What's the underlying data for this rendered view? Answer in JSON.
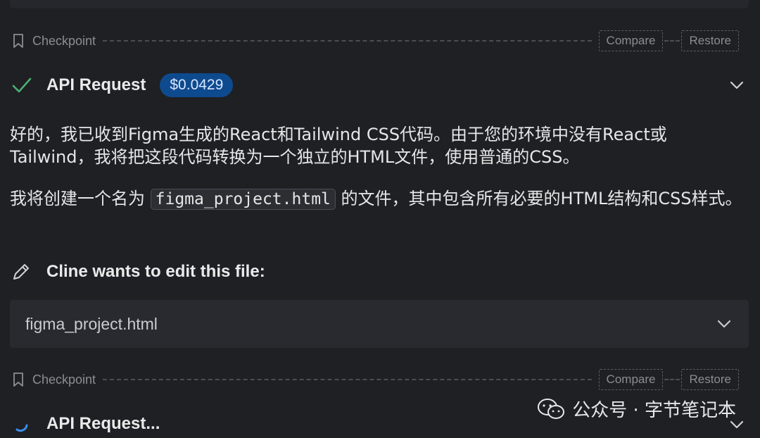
{
  "checkpoints": [
    {
      "label": "Checkpoint",
      "compare_label": "Compare",
      "restore_label": "Restore"
    },
    {
      "label": "Checkpoint",
      "compare_label": "Compare",
      "restore_label": "Restore"
    }
  ],
  "api_requests": [
    {
      "title": "API Request",
      "cost": "$0.0429",
      "status": "check-icon"
    },
    {
      "title": "API Request...",
      "status": "spinner-icon"
    }
  ],
  "message": {
    "para1": "好的，我已收到Figma生成的React和Tailwind CSS代码。由于您的环境中没有React或Tailwind，我将把这段代码转换为一个独立的HTML文件，使用普通的CSS。",
    "para2_before": "我将创建一个名为",
    "para2_code": "figma_project.html",
    "para2_after": "的文件，其中包含所有必要的HTML结构和CSS样式。"
  },
  "edit": {
    "title": "Cline wants to edit this file:",
    "file_name": "figma_project.html"
  },
  "watermark": {
    "text": "公众号 · 字节笔记本"
  },
  "colors": {
    "background": "#1f2024",
    "badge": "#0e4a8e",
    "check": "#4caf72",
    "spinner": "#3b8eea"
  }
}
